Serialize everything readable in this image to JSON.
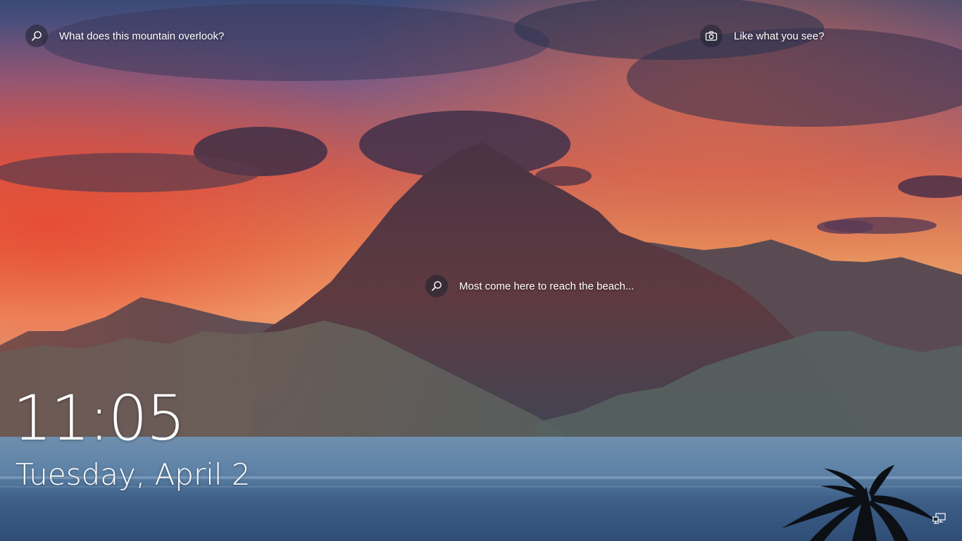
{
  "lock_screen": {
    "spotlight_hotspots": {
      "top_left": {
        "text": "What does this mountain overlook?",
        "icon": "search-icon"
      },
      "top_right": {
        "text": "Like what you see?",
        "icon": "camera-icon"
      },
      "middle": {
        "text": "Most come here to reach the beach...",
        "icon": "search-icon"
      }
    },
    "time": "11:05",
    "date": "Tuesday, April 2",
    "tray": {
      "icon": "network-icon"
    }
  },
  "colors": {
    "text": "#ffffff",
    "button_bg": "rgba(30,34,48,0.55)"
  }
}
